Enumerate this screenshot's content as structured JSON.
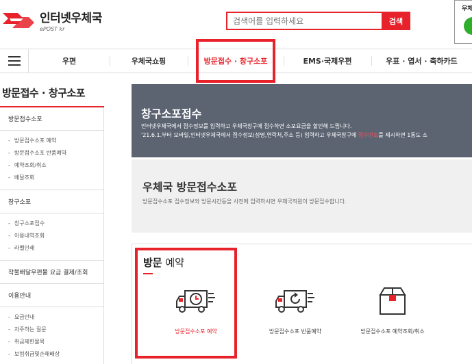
{
  "header": {
    "logo_title": "인터넷우체국",
    "logo_sub": "ePOST kr",
    "search_placeholder": "검색어를 입력하세요",
    "search_button": "검색",
    "status_label": "우체"
  },
  "nav": {
    "items": [
      "우편",
      "우체국쇼핑",
      "방문접수 · 창구소포",
      "EMS·국제우편",
      "우표 · 엽서 · 축하카드"
    ],
    "active_index": 2
  },
  "sidebar": {
    "title": "방문접수 · 창구소포",
    "sections": [
      {
        "head": "방문접수소포",
        "items": [
          "방문접수소포 예약",
          "방문접수소포 반품예약",
          "예약조회/취소",
          "배달조회"
        ]
      },
      {
        "head": "창구소포",
        "items": [
          "창구소포접수",
          "이용내역조회",
          "라벨인쇄"
        ]
      },
      {
        "head": "착불배달우편물 요금 결제/조회",
        "items": []
      },
      {
        "head": "이용안내",
        "items": [
          "요금안내",
          "자주하는 질문",
          "취급제한물목",
          "보험취급및손해배상"
        ]
      }
    ]
  },
  "banner_dark": {
    "title": "창구소포접수",
    "line1": "인터넷우체국에서 접수정보를 입력하고 우체국창구에 접수하면 소포요금을 할인해 드립니다.",
    "line2_a": "'21.6.1.부터 모바일,인터넷우체국에서 접수정보(성명,연락처,주소 등) 입력하고 우체국창구에 ",
    "line2_hl": "접수번호",
    "line2_b": "를 제시하면 1통도 소"
  },
  "banner_light": {
    "title": "우체국 방문접수소포",
    "desc": "방문접수소포 접수정보와 방문시간등을 사전에 입력하시면 우체국직원이 방문접수합니다."
  },
  "reserve": {
    "title_bold": "방문",
    "title_rest": " 예약",
    "options": [
      {
        "label": "방문접수소포 예약",
        "icon": "truck-clock-icon"
      },
      {
        "label": "방문접수소포 반품예약",
        "icon": "truck-return-icon"
      },
      {
        "label": "방문접수소포 예약조회/취소",
        "icon": "box-icon"
      }
    ]
  },
  "colors": {
    "accent": "#e8222b",
    "banner_dark": "#5c6472",
    "banner_light": "#f0f0f0",
    "status_ok": "#2fae2a"
  }
}
